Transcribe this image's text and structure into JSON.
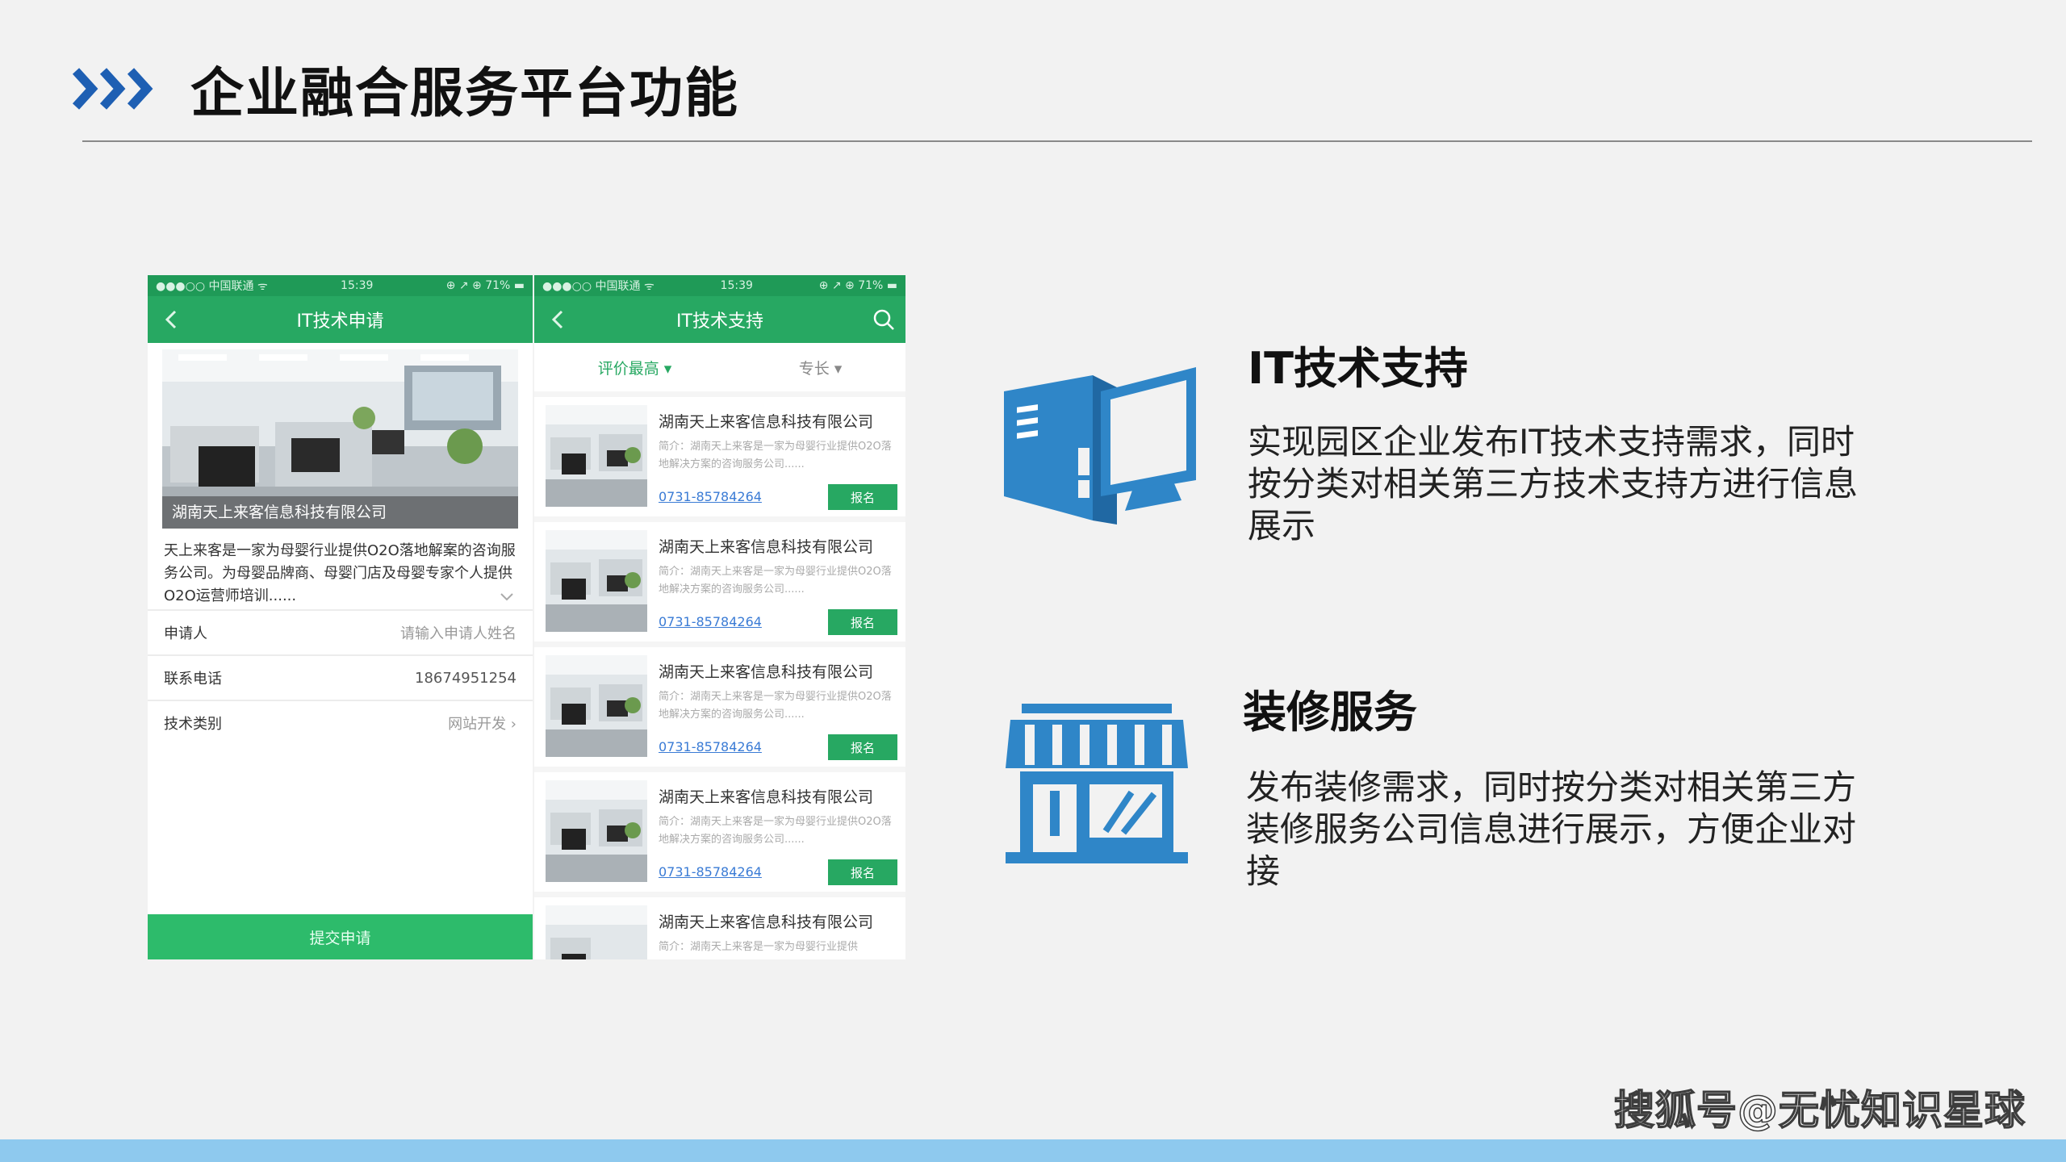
{
  "slide": {
    "title": "企业融合服务平台功能"
  },
  "phone_apply": {
    "status": {
      "carrier": "●●●○○ 中国联通 ᯤ",
      "time": "15:39",
      "right": "⊕ ↗ ⊕ 71% ▬"
    },
    "nav_title": "IT技术申请",
    "hero_caption": "湖南天上来客信息科技有限公司",
    "description": "天上来客是一家为母婴行业提供O2O落地解案的咨询服务公司。为母婴品牌商、母婴门店及母婴专家个人提供O2O运营师培训......",
    "form": [
      {
        "label": "申请人",
        "value": "请输入申请人姓名"
      },
      {
        "label": "联系电话",
        "value": "18674951254"
      },
      {
        "label": "技术类别",
        "value": "网站开发 ›"
      }
    ],
    "submit_label": "提交申请"
  },
  "phone_support": {
    "status": {
      "carrier": "●●●○○ 中国联通 ᯤ",
      "time": "15:39",
      "right": "⊕ ↗ ⊕ 71% ▬"
    },
    "nav_title": "IT技术支持",
    "filters": [
      "评价最高 ▾",
      "专长 ▾"
    ],
    "items": [
      {
        "company": "湖南天上来客信息科技有限公司",
        "intro": "简介：湖南天上来客是一家为母婴行业提供O2O落地解决方案的咨询服务公司......",
        "phone": "0731-85784264",
        "button": "报名"
      },
      {
        "company": "湖南天上来客信息科技有限公司",
        "intro": "简介：湖南天上来客是一家为母婴行业提供O2O落地解决方案的咨询服务公司......",
        "phone": "0731-85784264",
        "button": "报名"
      },
      {
        "company": "湖南天上来客信息科技有限公司",
        "intro": "简介：湖南天上来客是一家为母婴行业提供O2O落地解决方案的咨询服务公司......",
        "phone": "0731-85784264",
        "button": "报名"
      },
      {
        "company": "湖南天上来客信息科技有限公司",
        "intro": "简介：湖南天上来客是一家为母婴行业提供O2O落地解决方案的咨询服务公司......",
        "phone": "0731-85784264",
        "button": "报名"
      },
      {
        "company": "湖南天上来客信息科技有限公司",
        "intro": "简介：湖南天上来客是一家为母婴行业提供",
        "phone": "",
        "button": ""
      }
    ]
  },
  "features": {
    "it": {
      "title": "IT技术支持",
      "desc": "实现园区企业发布IT技术支持需求，同时按分类对相关第三方技术支持方进行信息展示",
      "icon": "computer-icon"
    },
    "deco": {
      "title": "装修服务",
      "desc": "发布装修需求，同时按分类对相关第三方装修服务公司信息进行展示，方便企业对接",
      "icon": "storefront-icon"
    }
  },
  "watermark": "搜狐号@无忧知识星球",
  "colors": {
    "accent_blue": "#2f86c8",
    "app_green": "#27a862",
    "footer": "#8ec9ee"
  }
}
